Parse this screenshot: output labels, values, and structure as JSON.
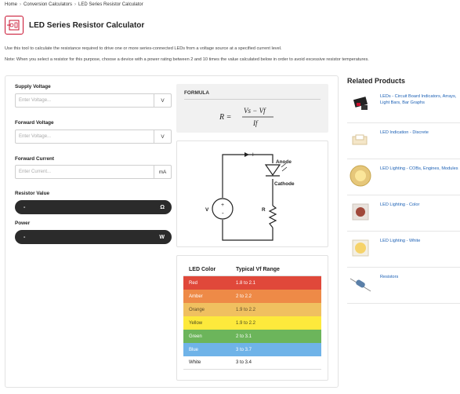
{
  "breadcrumb": {
    "home": "Home",
    "sep": "›",
    "category": "Conversion Calculators",
    "current": "LED Series Resistor Calculator"
  },
  "page": {
    "title": "LED Series Resistor Calculator",
    "intro": "Use this tool to calculate the resistance required to drive one or more series-connected LEDs from a voltage source at a specified current level.",
    "note": "Note: When you select a resistor for this purpose, choose a device with a power rating between 2 and 10 times the value calculated below in order to avoid excessive resistor temperatures."
  },
  "form": {
    "supply": {
      "label": "Supply Voltage",
      "placeholder": "Enter Voltage...",
      "unit": "V"
    },
    "forward_voltage": {
      "label": "Forward Voltage",
      "placeholder": "Enter Voltage...",
      "unit": "V"
    },
    "forward_current": {
      "label": "Forward Current",
      "placeholder": "Enter Current...",
      "unit": "mA"
    },
    "resistor": {
      "label": "Resistor Value",
      "value": "-",
      "unit": "Ω"
    },
    "power": {
      "label": "Power",
      "value": "-",
      "unit": "W"
    }
  },
  "formula": {
    "label": "FORMULA",
    "lhs": "R =",
    "num": "Vs − Vf",
    "den": "If"
  },
  "circuit": {
    "current_label": "I",
    "anode_label": "Anode",
    "cathode_label": "Cathode",
    "v_label": "V",
    "r_label": "R",
    "plus": "+",
    "minus": "-"
  },
  "led_table": {
    "col_color": "LED Color",
    "col_range": "Typical Vf Range",
    "rows": [
      {
        "color": "Red",
        "range": "1.8 to 2.1",
        "bg": "#e0483a"
      },
      {
        "color": "Amber",
        "range": "2 to 2.2",
        "bg": "#ee8a47"
      },
      {
        "color": "Orange",
        "range": "1.9 to 2.2",
        "bg": "#f0c060"
      },
      {
        "color": "Yellow",
        "range": "1.9 to 2.2",
        "bg": "#fde93c"
      },
      {
        "color": "Green",
        "range": "2 to 3.1",
        "bg": "#6cb55b"
      },
      {
        "color": "Blue",
        "range": "3 to 3.7",
        "bg": "#6fb3e8"
      },
      {
        "color": "White",
        "range": "3 to 3.4",
        "bg": "#ffffff"
      }
    ]
  },
  "related": {
    "title": "Related Products",
    "items": [
      {
        "label": "LEDs - Circuit Board Indicators, Arrays, Light Bars, Bar Graphs",
        "icon": "led-array-icon"
      },
      {
        "label": "LED Indication - Discrete",
        "icon": "discrete-led-icon"
      },
      {
        "label": "LED Lighting - COBs, Engines, Modules",
        "icon": "cob-led-icon"
      },
      {
        "label": "LED Lighting - Color",
        "icon": "color-led-icon"
      },
      {
        "label": "LED Lighting - White",
        "icon": "white-led-icon"
      },
      {
        "label": "Resistors",
        "icon": "resistor-icon"
      }
    ]
  }
}
